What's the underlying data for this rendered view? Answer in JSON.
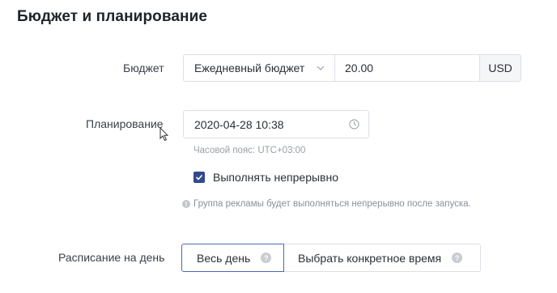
{
  "section": {
    "title": "Бюджет и планирование"
  },
  "budget": {
    "label": "Бюджет",
    "type_value": "Ежедневный бюджет",
    "amount": "20.00",
    "currency": "USD"
  },
  "schedule": {
    "label": "Планирование",
    "datetime": "2020-04-28 10:38",
    "timezone_note": "Часовой пояс: UTC+03:00",
    "continuous_label": "Выполнять непрерывно",
    "continuous_checked": true,
    "info_text": "Группа рекламы будет выполняться непрерывно после запуска."
  },
  "day_schedule": {
    "label": "Расписание на день",
    "options": [
      {
        "label": "Весь день",
        "selected": true
      },
      {
        "label": "Выбрать конкретное время",
        "selected": false
      }
    ]
  },
  "colors": {
    "accent": "#324a8b",
    "active_border": "#4a6ab8",
    "border": "#dcdfe6",
    "muted_text": "#9aa0a8"
  },
  "icons": {
    "dropdown": "chevron-down-icon",
    "clock": "clock-icon",
    "check": "check-icon",
    "info": "info-icon",
    "help": "help-icon",
    "cursor": "mouse-cursor-icon"
  }
}
